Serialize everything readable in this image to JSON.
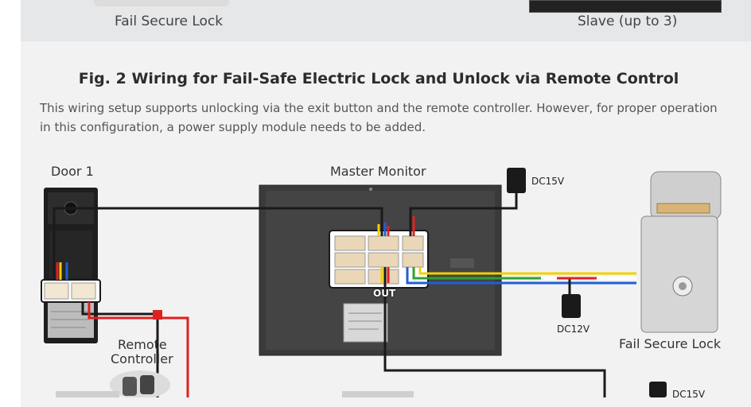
{
  "top": {
    "left_caption": "Fail Secure Lock",
    "right_caption": "Slave (up to 3)"
  },
  "figure": {
    "title": "Fig. 2 Wiring for Fail-Safe Electric Lock and Unlock via Remote Control",
    "description": "This wiring setup supports unlocking via the exit button and the remote controller. However, for proper operation in this configuration, a power supply module needs to be added."
  },
  "labels": {
    "door": "Door 1",
    "master": "Master Monitor",
    "dc15v_top": "DC15V",
    "dc12v": "DC12V",
    "lock": "Fail Secure Lock",
    "remote_line1": "Remote",
    "remote_line2": "Controller",
    "out": "OUT",
    "dc15v_bottom": "DC15V"
  },
  "colors": {
    "red": "#e02020",
    "black": "#1a1a1a",
    "yellow": "#f2d000",
    "blue": "#1f5fd6",
    "green": "#2fa32f",
    "panel": "#f2f2f2",
    "monitor": "#3a3a3a"
  }
}
